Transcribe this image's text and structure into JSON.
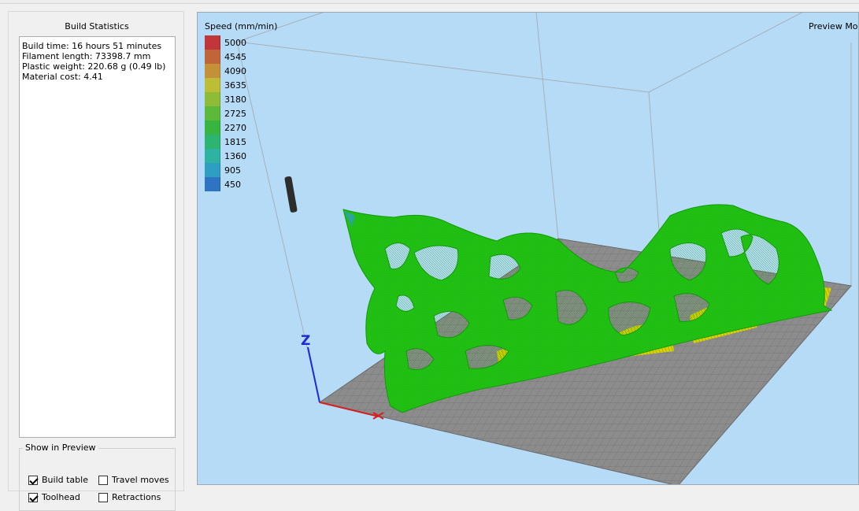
{
  "left_panel": {
    "title": "Build Statistics",
    "stats": [
      "Build time: 16 hours 51 minutes",
      "Filament length: 73398.7 mm",
      "Plastic weight: 220.68 g (0.49 lb)",
      "Material cost: 4.41"
    ]
  },
  "show_in_preview": {
    "title": "Show in Preview",
    "options": [
      {
        "label": "Build table",
        "checked": true
      },
      {
        "label": "Travel moves",
        "checked": false
      },
      {
        "label": "Toolhead",
        "checked": true
      },
      {
        "label": "Retractions",
        "checked": false
      }
    ]
  },
  "viewport": {
    "legend_title": "Speed (mm/min)",
    "mode_label": "Preview Mode",
    "axis_label": "Z",
    "legend": [
      {
        "value": "5000",
        "color": "#c0363a"
      },
      {
        "value": "4545",
        "color": "#c0653a"
      },
      {
        "value": "4090",
        "color": "#c49138"
      },
      {
        "value": "3635",
        "color": "#bdbe38"
      },
      {
        "value": "3180",
        "color": "#8ebc38"
      },
      {
        "value": "2725",
        "color": "#5cb93a"
      },
      {
        "value": "2270",
        "color": "#36b541"
      },
      {
        "value": "1815",
        "color": "#2db471"
      },
      {
        "value": "1360",
        "color": "#2eb3a3"
      },
      {
        "value": "905",
        "color": "#2e9ec2"
      },
      {
        "value": "450",
        "color": "#2d75c2"
      }
    ],
    "colors": {
      "background": "#b6dbf6",
      "bed": "#8c8c8c",
      "model": "#22c414",
      "infill": "#d6d300"
    }
  }
}
